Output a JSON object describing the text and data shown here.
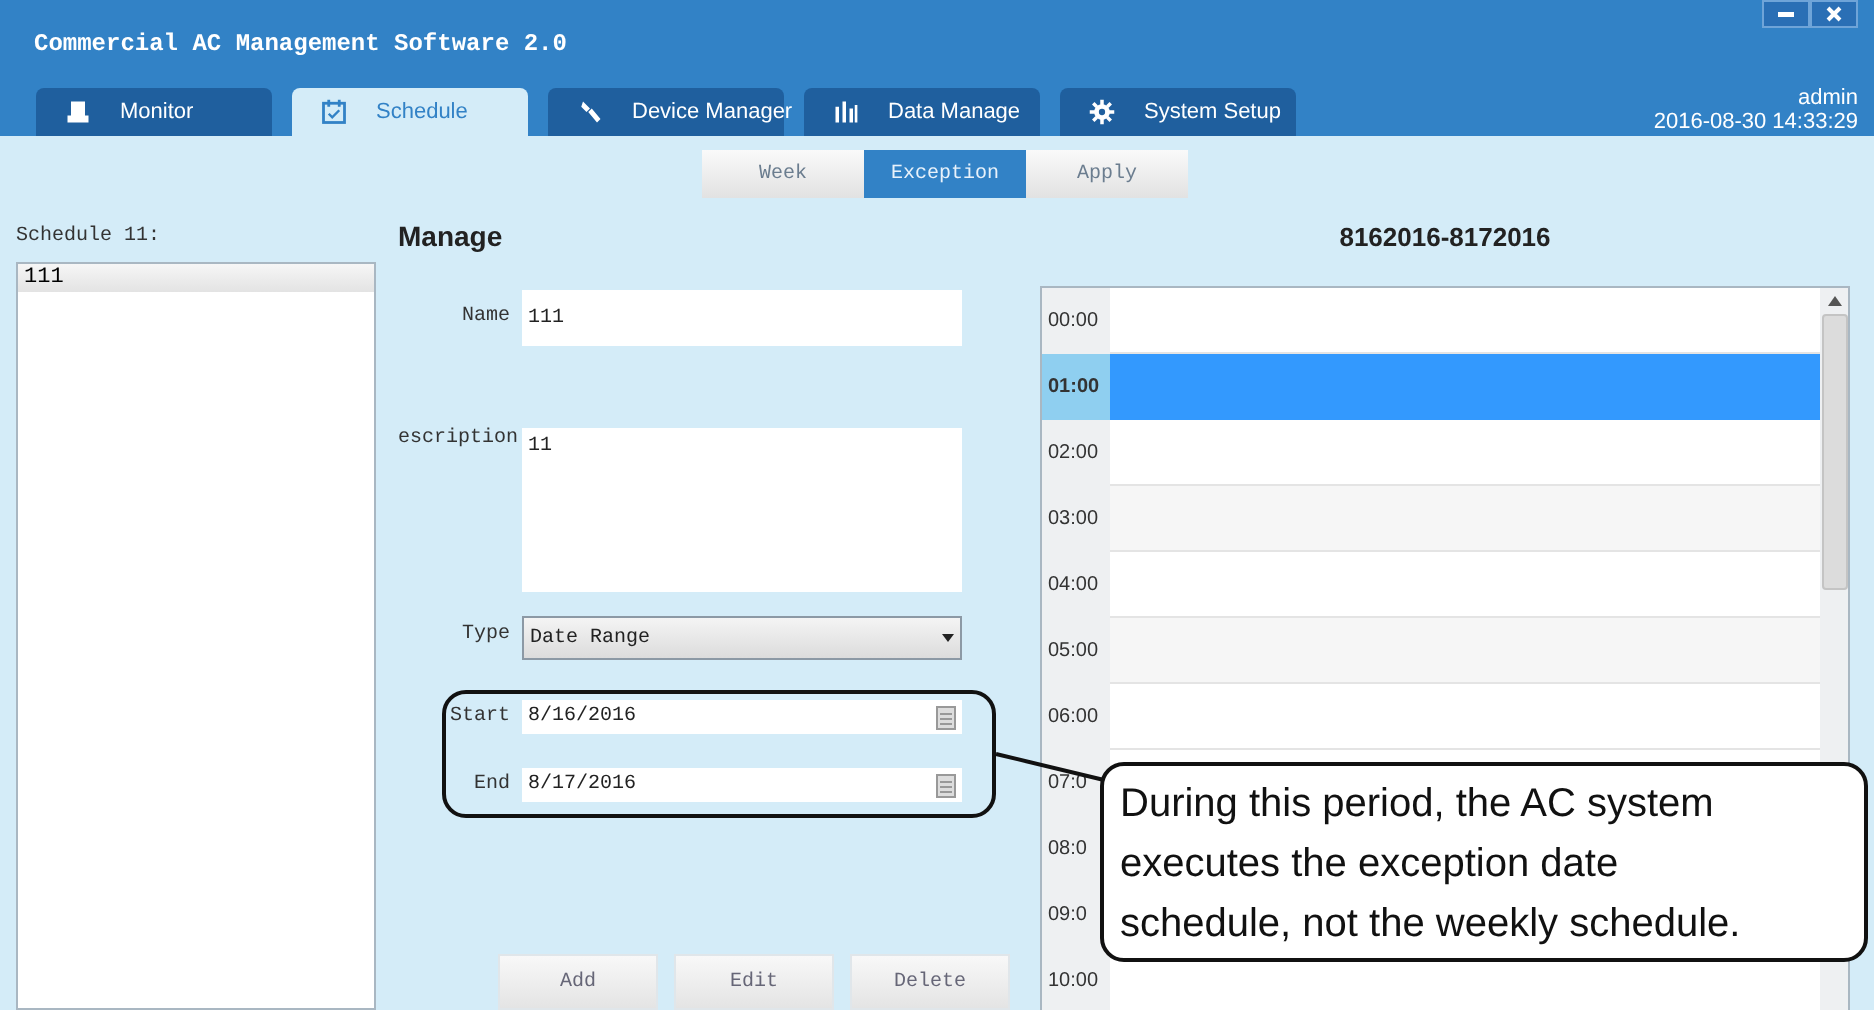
{
  "window": {
    "title": "Commercial AC Management Software 2.0"
  },
  "tabs": [
    {
      "label": "Monitor",
      "selected": false
    },
    {
      "label": "Schedule",
      "selected": true
    },
    {
      "label": "Device Manager",
      "selected": false
    },
    {
      "label": "Data Manage",
      "selected": false
    },
    {
      "label": "System Setup",
      "selected": false
    }
  ],
  "user": {
    "name": "admin",
    "datetime": "2016-08-30 14:33:29"
  },
  "subtabs": [
    {
      "label": "Week",
      "selected": false
    },
    {
      "label": "Exception",
      "selected": true
    },
    {
      "label": "Apply",
      "selected": false
    }
  ],
  "schedule_list": {
    "label": "Schedule 11:",
    "items": [
      {
        "label": "111",
        "selected": true
      }
    ]
  },
  "manage": {
    "title": "Manage",
    "fields": [
      {
        "kind": "text",
        "label": "Name",
        "value": "111"
      },
      {
        "kind": "textarea",
        "label": "escription",
        "value": "11"
      },
      {
        "kind": "select",
        "label": "Type",
        "value": "Date Range"
      },
      {
        "kind": "date",
        "label": "Start",
        "value": "8/16/2016"
      },
      {
        "kind": "date",
        "label": "End",
        "value": "8/17/2016"
      }
    ],
    "buttons": [
      "Add",
      "Edit",
      "Delete"
    ]
  },
  "timetable": {
    "title": "8162016-8172016",
    "rows": [
      {
        "time": "00:00",
        "selected": false
      },
      {
        "time": "01:00",
        "selected": true
      },
      {
        "time": "02:00",
        "selected": false
      },
      {
        "time": "03:00",
        "selected": false
      },
      {
        "time": "04:00",
        "selected": false
      },
      {
        "time": "05:00",
        "selected": false
      },
      {
        "time": "06:00",
        "selected": false
      },
      {
        "time": "07:0",
        "selected": false
      },
      {
        "time": "08:0",
        "selected": false
      },
      {
        "time": "09:0",
        "selected": false
      },
      {
        "time": "10:00",
        "selected": false
      }
    ]
  },
  "callout": {
    "text": "During this period, the AC system executes the exception date schedule, not the weekly schedule."
  }
}
